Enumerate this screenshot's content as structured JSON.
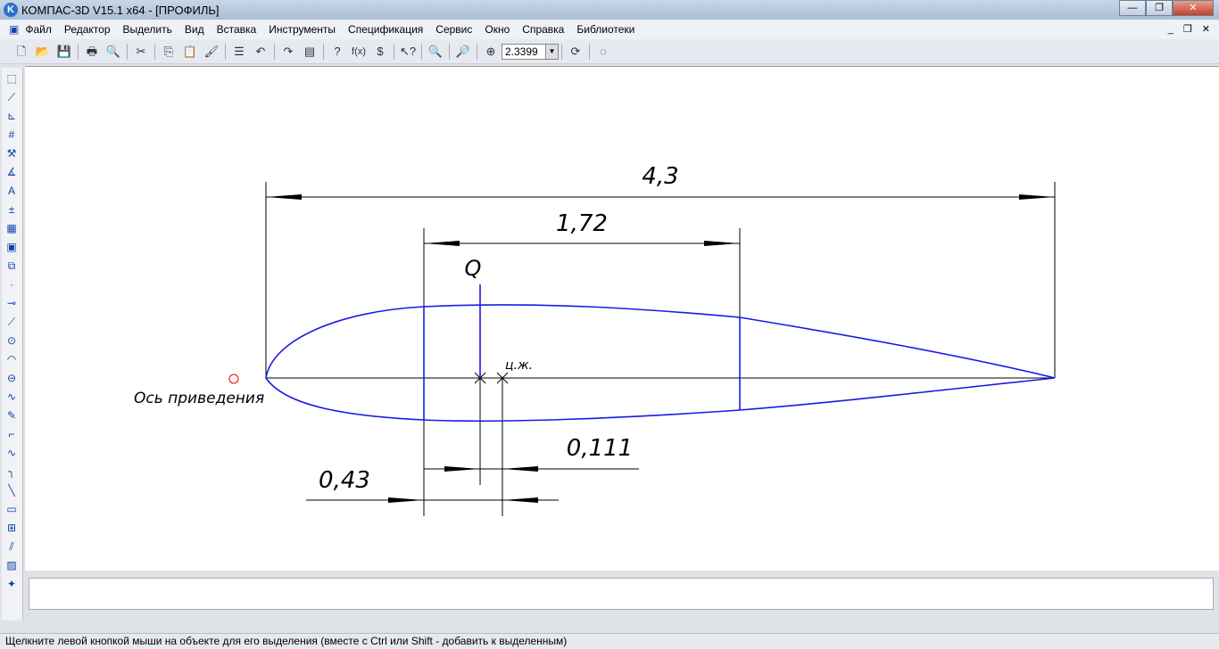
{
  "window": {
    "title": "КОМПАС-3D V15.1 x64 - [ПРОФИЛЬ]",
    "logo": "K"
  },
  "menu": [
    "Файл",
    "Редактор",
    "Выделить",
    "Вид",
    "Вставка",
    "Инструменты",
    "Спецификация",
    "Сервис",
    "Окно",
    "Справка",
    "Библиотеки"
  ],
  "toolbar": {
    "zoom_value": "2.3399",
    "icons": [
      "new-document-icon",
      "open-icon",
      "save-icon",
      "print-icon",
      "preview-icon",
      "cut-icon",
      "copy-icon",
      "paste-icon",
      "properties-brush-icon",
      "list-icon",
      "undo-icon",
      "redo-icon",
      "manager-icon",
      "variables-icon",
      "function-icon",
      "units-icon",
      "help-pointer-icon",
      "zoom-window-icon",
      "zoom-selection-icon",
      "zoom-in-icon",
      "refresh-icon",
      "disabled-tool-icon"
    ]
  },
  "drawing": {
    "dim_chord": "4,3",
    "dim_box": "1,72",
    "force_label": "Q",
    "cg_label": "ц.ж.",
    "dim_offset": "0,111",
    "dim_axis": "0,43",
    "axis_label": "Ось приведения",
    "line_color": "#1a1ae6"
  },
  "status": "Щелкните левой кнопкой мыши на объекте для его выделения (вместе с Ctrl или Shift - добавить к выделенным)"
}
